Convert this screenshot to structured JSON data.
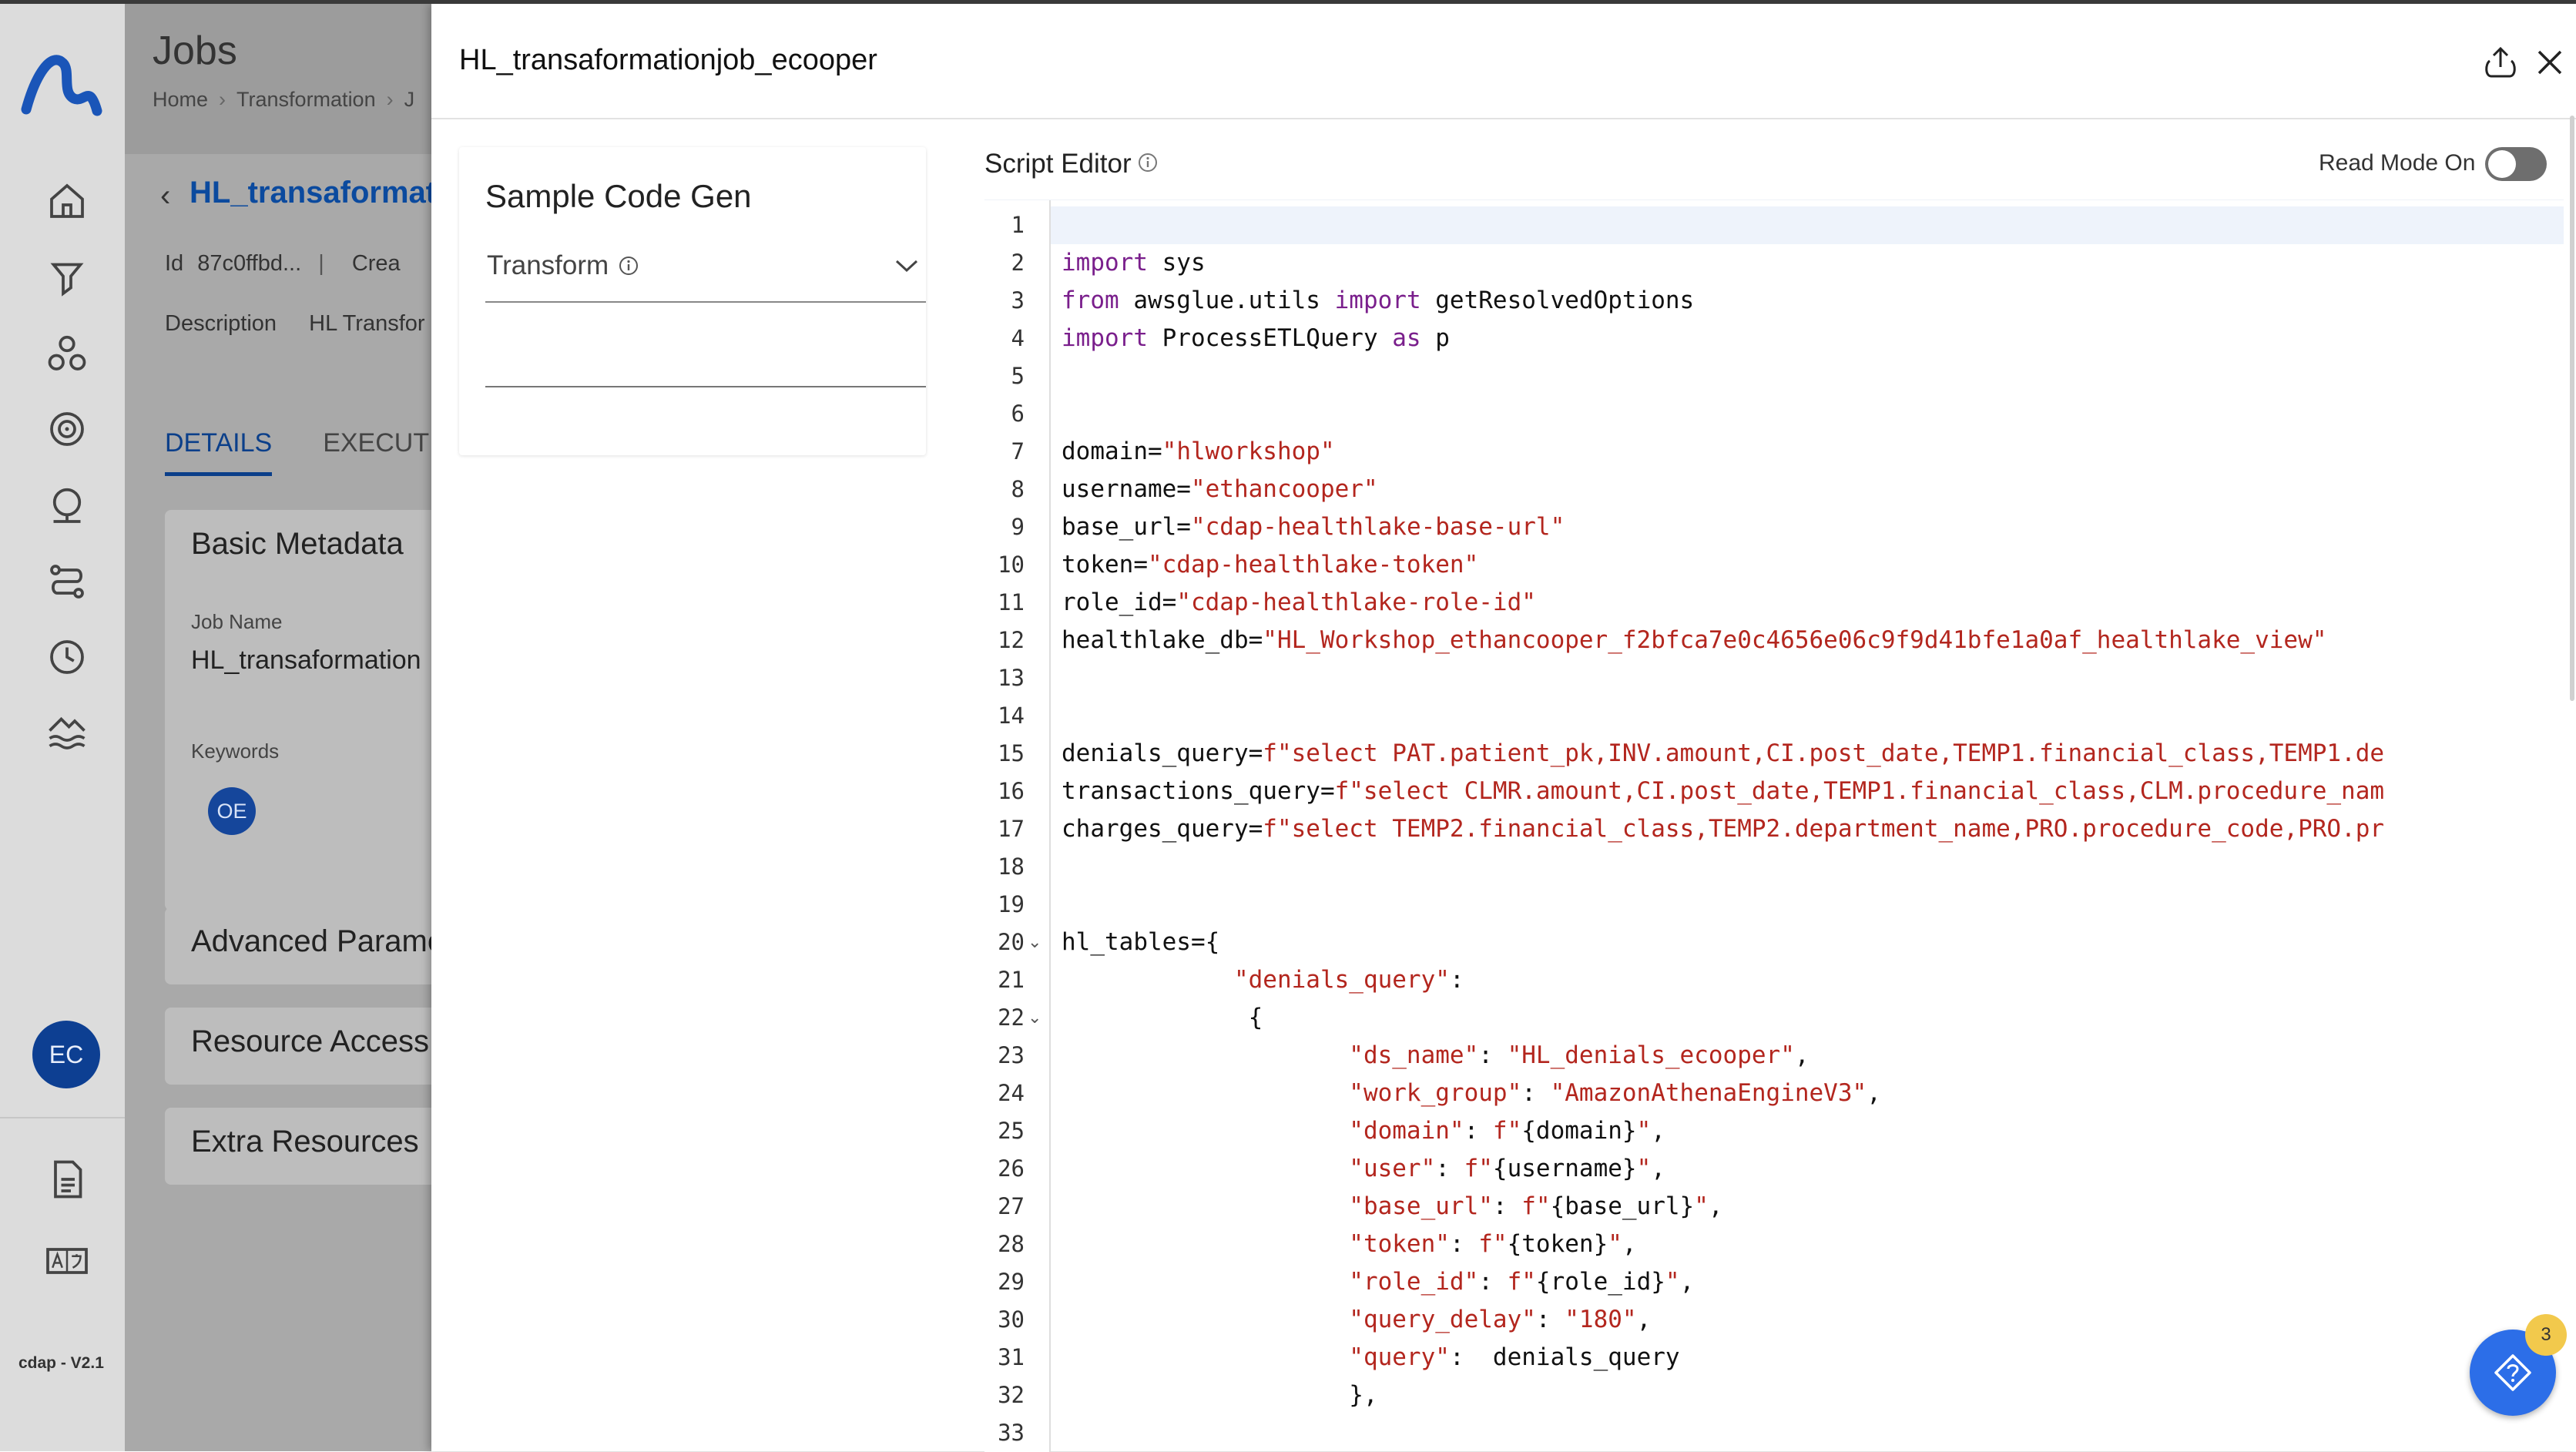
{
  "app": {
    "version": "cdap - V2.1",
    "user_initials": "EC"
  },
  "page": {
    "title": "Jobs",
    "breadcrumb": [
      "Home",
      "Transformation",
      "J"
    ]
  },
  "job": {
    "name_link": "HL_transaformati",
    "id_label": "Id",
    "id_value": "87c0ffbd...",
    "created_label": "Crea",
    "description_label": "Description",
    "description_value": "HL Transfor",
    "tabs": [
      "DETAILS",
      "EXECUTI"
    ],
    "cards": {
      "basic": {
        "title": "Basic Metadata",
        "job_name_label": "Job Name",
        "job_name_value": "HL_transaformation",
        "keywords_label": "Keywords",
        "keyword_badge": "OE"
      },
      "advanced": "Advanced Parame",
      "resource": "Resource Access",
      "extra": "Extra Resources"
    }
  },
  "drawer": {
    "title": "HL_transaformationjob_ecooper",
    "sample_code_gen": {
      "title": "Sample Code Gen",
      "select_value": "Transform"
    },
    "script_editor": {
      "title": "Script Editor",
      "read_mode_label": "Read Mode On",
      "read_mode_on": false,
      "fold_lines": [
        20,
        22
      ],
      "lines": [
        "",
        "import sys",
        "from awsglue.utils import getResolvedOptions",
        "import ProcessETLQuery as p",
        "",
        "",
        "domain=\"hlworkshop\"",
        "username=\"ethancooper\"",
        "base_url=\"cdap-healthlake-base-url\"",
        "token=\"cdap-healthlake-token\"",
        "role_id=\"cdap-healthlake-role-id\"",
        "healthlake_db=\"HL_Workshop_ethancooper_f2bfca7e0c4656e06c9f9d41bfe1a0af_healthlake_view\"",
        "",
        "",
        "denials_query=f\"select PAT.patient_pk,INV.amount,CI.post_date,TEMP1.financial_class,TEMP1.de",
        "transactions_query=f\"select CLMR.amount,CI.post_date,TEMP1.financial_class,CLM.procedure_nam",
        "charges_query=f\"select TEMP2.financial_class,TEMP2.department_name,PRO.procedure_code,PRO.pr",
        "",
        "",
        "hl_tables={",
        "            \"denials_query\":",
        "             {",
        "                    \"ds_name\": \"HL_denials_ecooper\",",
        "                    \"work_group\": \"AmazonAthenaEngineV3\",",
        "                    \"domain\": f\"{domain}\",",
        "                    \"user\": f\"{username}\",",
        "                    \"base_url\": f\"{base_url}\",",
        "                    \"token\": f\"{token}\",",
        "                    \"role_id\": f\"{role_id}\",",
        "                    \"query_delay\": \"180\",",
        "                    \"query\":  denials_query",
        "                    },",
        ""
      ]
    }
  },
  "help": {
    "badge_count": "3"
  },
  "colors": {
    "keyword": "#7a1f8c",
    "string": "#b3261e",
    "brand": "#0d3f92",
    "fab": "#2c6ee8",
    "badge": "#f2c94c"
  }
}
